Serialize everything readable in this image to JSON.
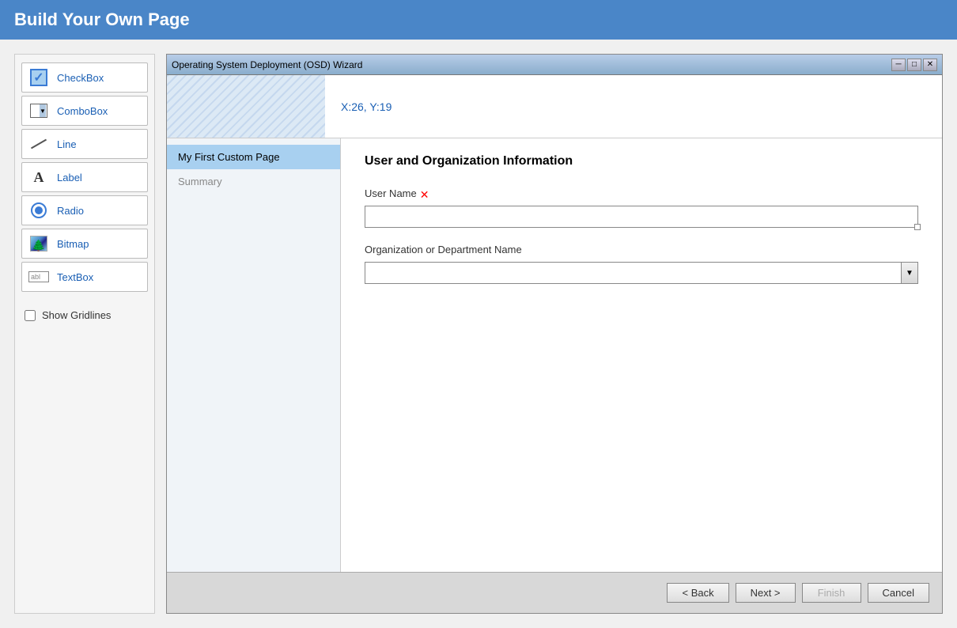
{
  "app": {
    "title": "Build Your Own Page"
  },
  "toolbar": {
    "items": [
      {
        "id": "checkbox",
        "label": "CheckBox",
        "icon": "checkbox-icon"
      },
      {
        "id": "combobox",
        "label": "ComboBox",
        "icon": "combobox-icon"
      },
      {
        "id": "line",
        "label": "Line",
        "icon": "line-icon"
      },
      {
        "id": "label",
        "label": "Label",
        "icon": "label-icon"
      },
      {
        "id": "radio",
        "label": "Radio",
        "icon": "radio-icon"
      },
      {
        "id": "bitmap",
        "label": "Bitmap",
        "icon": "bitmap-icon"
      },
      {
        "id": "textbox",
        "label": "TextBox",
        "icon": "textbox-icon"
      }
    ],
    "show_gridlines_label": "Show Gridlines"
  },
  "wizard": {
    "title": "Operating System Deployment (OSD) Wizard",
    "controls": {
      "minimize": "─",
      "maximize": "□",
      "close": "✕"
    },
    "coords": "X:26, Y:19",
    "nav_items": [
      {
        "id": "custom-page",
        "label": "My First Custom Page",
        "active": true
      },
      {
        "id": "summary",
        "label": "Summary",
        "active": false
      }
    ],
    "content": {
      "section_title": "User and Organization Information",
      "fields": [
        {
          "id": "user-name",
          "label": "User Name",
          "required": true,
          "type": "text",
          "value": ""
        },
        {
          "id": "org-dept",
          "label": "Organization or Department Name",
          "required": false,
          "type": "combobox",
          "value": ""
        }
      ]
    },
    "footer": {
      "back_label": "< Back",
      "next_label": "Next >",
      "finish_label": "Finish",
      "cancel_label": "Cancel"
    }
  }
}
